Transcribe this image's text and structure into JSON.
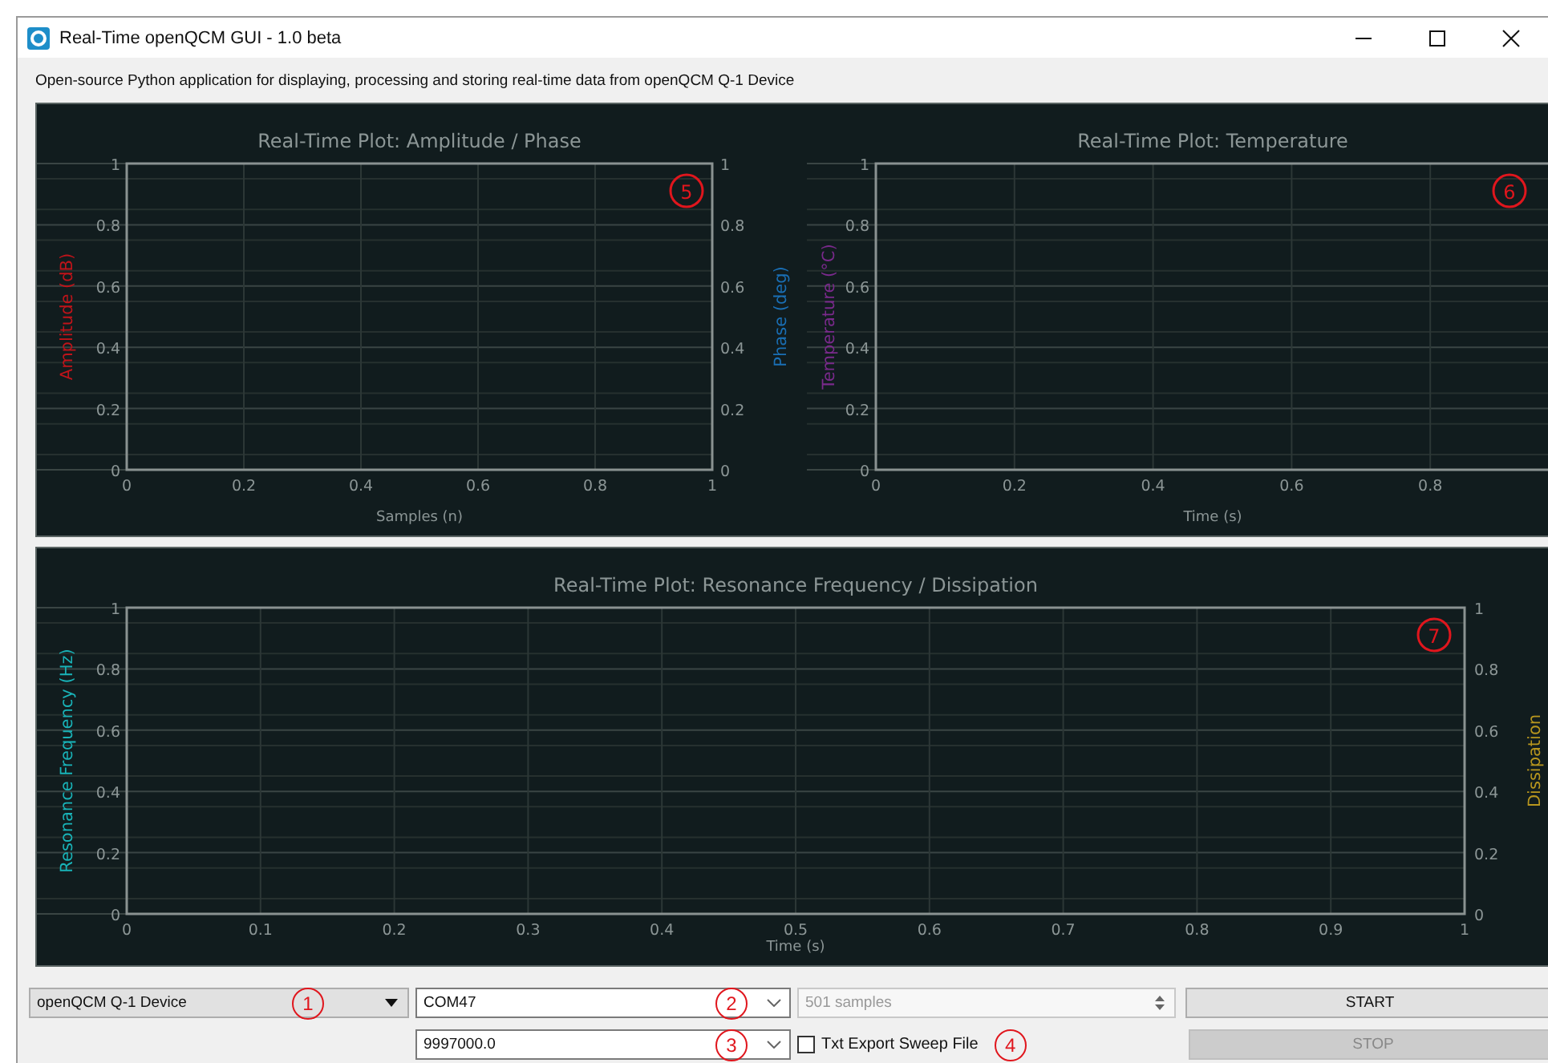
{
  "window": {
    "title": "Real-Time openQCM GUI - 1.0 beta"
  },
  "description": "Open-source Python application for displaying, processing and storing real-time data from openQCM Q-1 Device",
  "plots": [
    {
      "callout": "5",
      "left_axis": {
        "color": "#c0141a"
      },
      "right_axis": {
        "label": "Phase (deg)",
        "color": "#1a6fb5",
        "ticks": [
          "1",
          "0.8",
          "0.6",
          "0.4",
          "0.2",
          "0"
        ]
      },
      "chart_data": {
        "type": "line",
        "title": "Real-Time Plot: Amplitude / Phase",
        "xlabel": "Samples (n)",
        "ylabel": "Amplitude (dB)",
        "xlim": [
          0,
          1
        ],
        "ylim": [
          0,
          1
        ],
        "xticks": [
          0,
          0.2,
          0.4,
          0.6,
          0.8,
          1
        ],
        "yticks": [
          0,
          0.2,
          0.4,
          0.6,
          0.8,
          1
        ],
        "grid": true
      }
    },
    {
      "callout": "6",
      "left_axis": {
        "color": "#7a2a8c"
      },
      "chart_data": {
        "type": "line",
        "title": "Real-Time Plot: Temperature",
        "xlabel": "Time (s)",
        "ylabel": "Temperature (°C)",
        "xlim": [
          0,
          1
        ],
        "ylim": [
          0,
          1
        ],
        "xticks": [
          0,
          0.2,
          0.4,
          0.6,
          0.8
        ],
        "yticks": [
          0,
          0.2,
          0.4,
          0.6,
          0.8,
          1
        ],
        "grid": true
      }
    },
    {
      "callout": "7",
      "left_axis": {
        "color": "#19b3b8"
      },
      "right_axis": {
        "label": "Dissipation",
        "color": "#b8961e",
        "ticks": [
          "1",
          "0.8",
          "0.6",
          "0.4",
          "0.2",
          "0"
        ]
      },
      "chart_data": {
        "type": "line",
        "title": "Real-Time Plot: Resonance Frequency / Dissipation",
        "xlabel": "Time (s)",
        "ylabel": "Resonance Frequency (Hz)",
        "xlim": [
          0,
          1
        ],
        "ylim": [
          0,
          1
        ],
        "xticks": [
          0,
          0.1,
          0.2,
          0.3,
          0.4,
          0.5,
          0.6,
          0.7,
          0.8,
          0.9,
          1
        ],
        "yticks": [
          0,
          0.2,
          0.4,
          0.6,
          0.8,
          1
        ],
        "grid": true
      }
    }
  ],
  "controls": {
    "device": {
      "value": "openQCM Q-1 Device",
      "callout": "1"
    },
    "port": {
      "value": "COM47",
      "callout": "2"
    },
    "samples": {
      "value": "501 samples",
      "disabled": true
    },
    "start": {
      "label": "START",
      "disabled": false
    },
    "frequency": {
      "value": "9997000.0",
      "callout": "3"
    },
    "export": {
      "label": "Txt Export Sweep File",
      "checked": false,
      "callout": "4"
    },
    "stop": {
      "label": "STOP",
      "disabled": true
    }
  }
}
